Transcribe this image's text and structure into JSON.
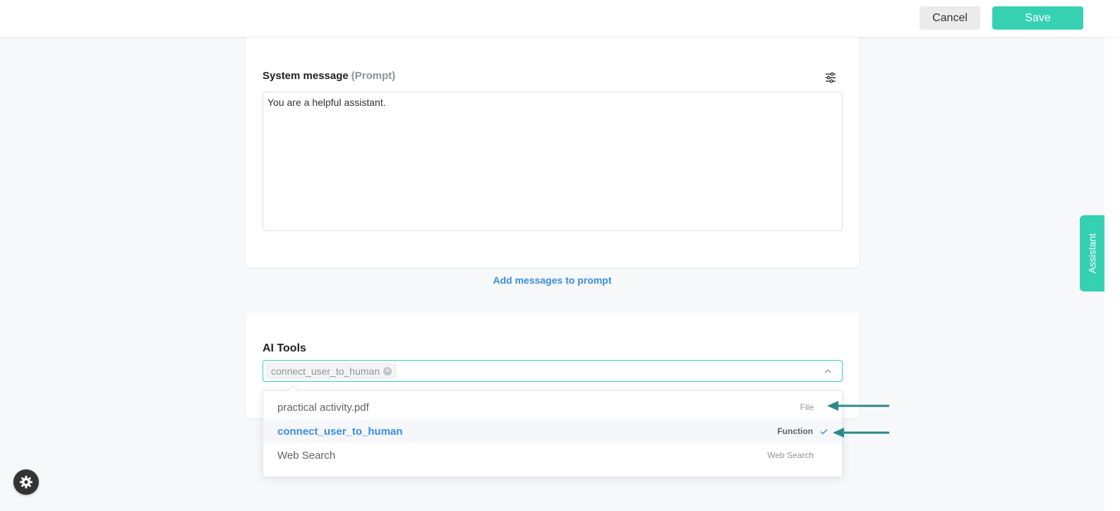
{
  "topbar": {
    "cancel_label": "Cancel",
    "save_label": "Save"
  },
  "system_message": {
    "title": "System message",
    "subtitle": "(Prompt)",
    "value": "You are a helpful assistant."
  },
  "add_messages_label": "Add messages to prompt",
  "ai_tools": {
    "title": "AI Tools",
    "selected_tags": [
      "connect_user_to_human"
    ],
    "options": [
      {
        "label": "practical activity.pdf",
        "type": "File",
        "selected": false
      },
      {
        "label": "connect_user_to_human",
        "type": "Function",
        "selected": true
      },
      {
        "label": "Web Search",
        "type": "Web Search",
        "selected": false
      }
    ]
  },
  "assistant_tab_label": "Assistant",
  "colors": {
    "accent": "#36d1b2",
    "link": "#3a8ee6",
    "annotation_arrow": "#2a8a86"
  }
}
